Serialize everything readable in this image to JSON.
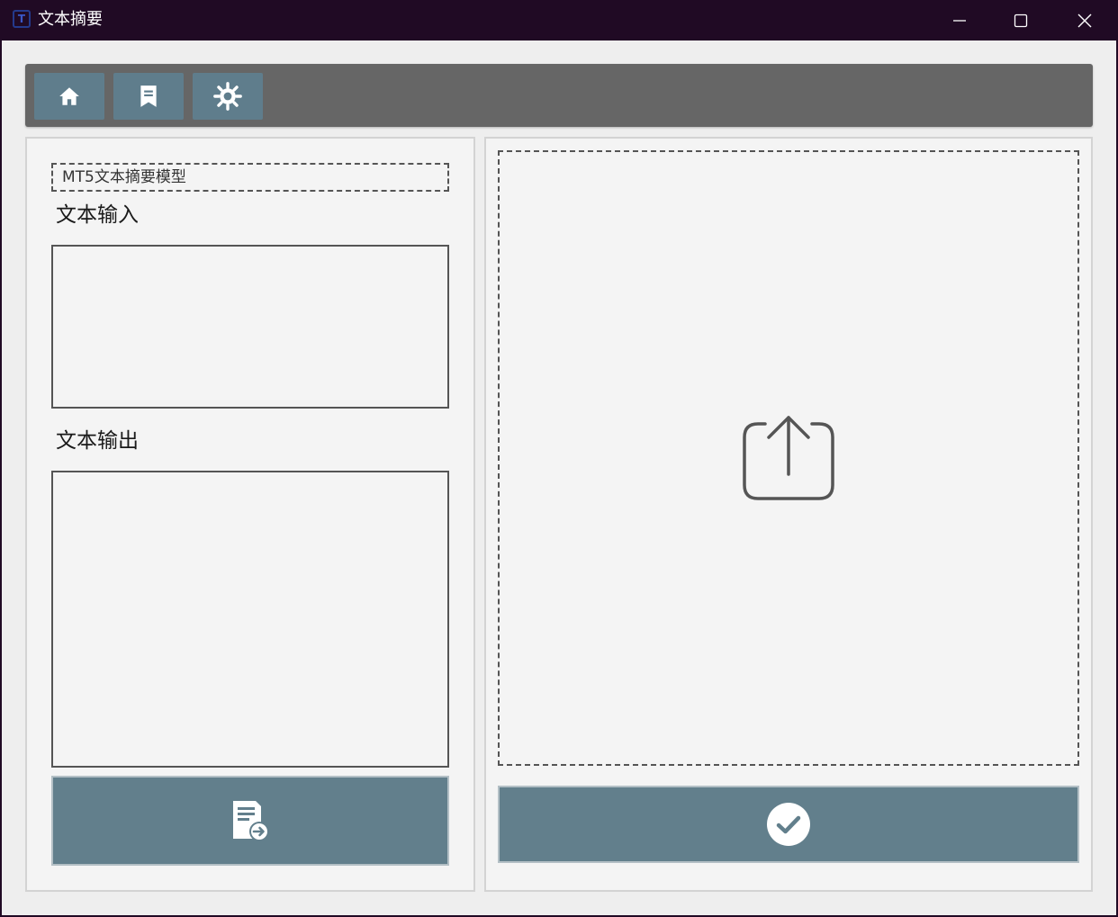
{
  "window": {
    "title": "文本摘要",
    "app_icon_glyph": "T",
    "controls": [
      "minimize-icon",
      "maximize-icon",
      "close-icon"
    ]
  },
  "toolbar": {
    "buttons": [
      {
        "icon": "home-icon"
      },
      {
        "icon": "bookmark-icon"
      },
      {
        "icon": "gear-icon"
      }
    ]
  },
  "left_panel": {
    "model_label": "MT5文本摘要模型",
    "input_label": "文本输入",
    "input_value": "",
    "output_label": "文本输出",
    "output_value": "",
    "action_icon": "document-export-icon"
  },
  "right_panel": {
    "drop_zone_icon": "upload-icon",
    "confirm_icon": "check-circle-icon"
  },
  "colors": {
    "titlebar": "#200a24",
    "toolbar": "#666666",
    "button": "#5f7d8c",
    "panel": "#f4f4f4"
  }
}
